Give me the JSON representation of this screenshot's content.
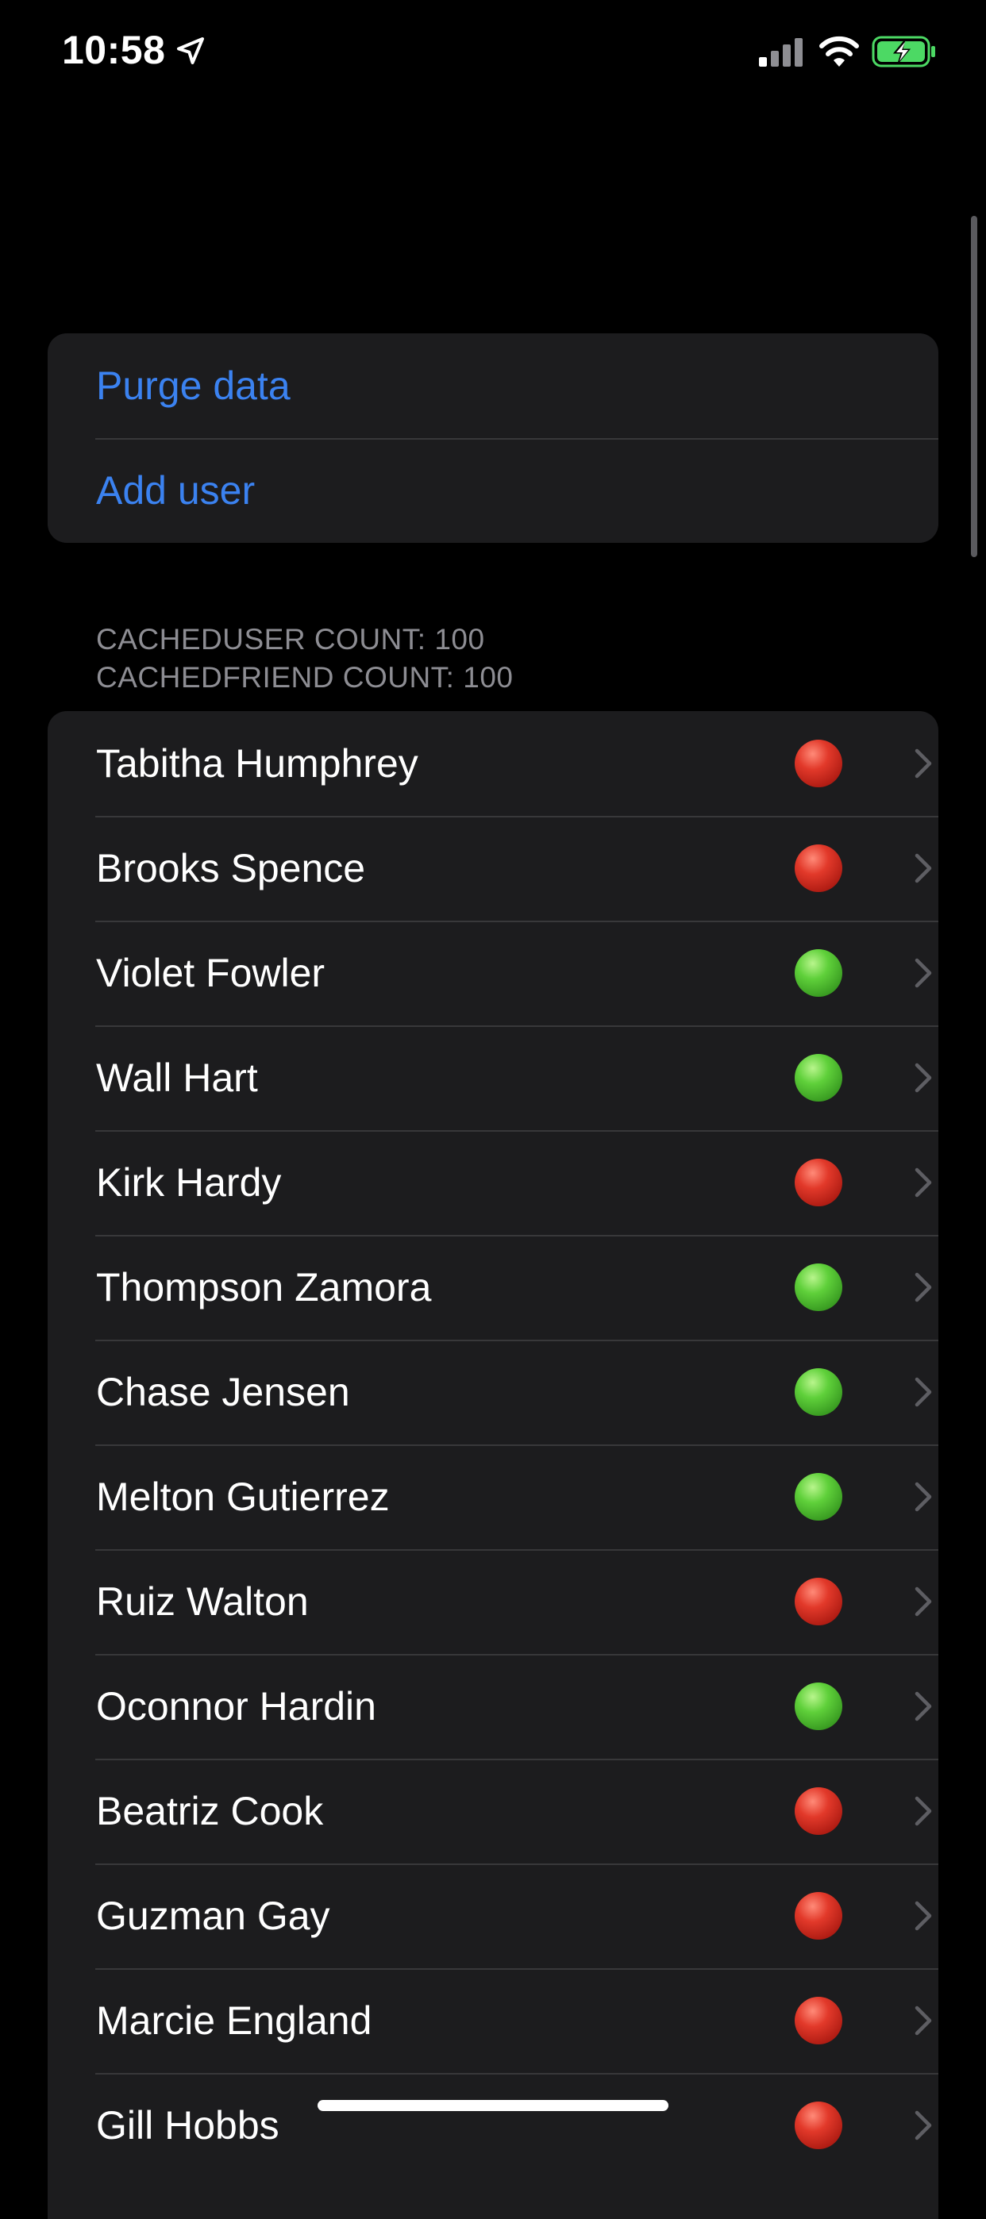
{
  "status_bar": {
    "time": "10:58",
    "icons": [
      "location-arrow-icon",
      "cellular-signal-icon",
      "wifi-icon",
      "battery-charging-icon"
    ]
  },
  "actions": {
    "purge_label": "Purge data",
    "add_label": "Add user"
  },
  "section_header": {
    "line1": "CACHEDUSER COUNT: 100",
    "line2": "CACHEDFRIEND COUNT: 100"
  },
  "users": [
    {
      "name": "Tabitha Humphrey",
      "status": "red"
    },
    {
      "name": "Brooks Spence",
      "status": "red"
    },
    {
      "name": "Violet Fowler",
      "status": "green"
    },
    {
      "name": "Wall Hart",
      "status": "green"
    },
    {
      "name": "Kirk Hardy",
      "status": "red"
    },
    {
      "name": "Thompson Zamora",
      "status": "green"
    },
    {
      "name": "Chase Jensen",
      "status": "green"
    },
    {
      "name": "Melton Gutierrez",
      "status": "green"
    },
    {
      "name": "Ruiz Walton",
      "status": "red"
    },
    {
      "name": "Oconnor Hardin",
      "status": "green"
    },
    {
      "name": "Beatriz Cook",
      "status": "red"
    },
    {
      "name": "Guzman Gay",
      "status": "red"
    },
    {
      "name": "Marcie England",
      "status": "red"
    },
    {
      "name": "Gill Hobbs",
      "status": "red"
    }
  ],
  "colors": {
    "accent": "#3b82f0",
    "background": "#000000",
    "cell": "#1c1c1e",
    "status_red": "#e2392a",
    "status_green": "#5fd03a"
  }
}
